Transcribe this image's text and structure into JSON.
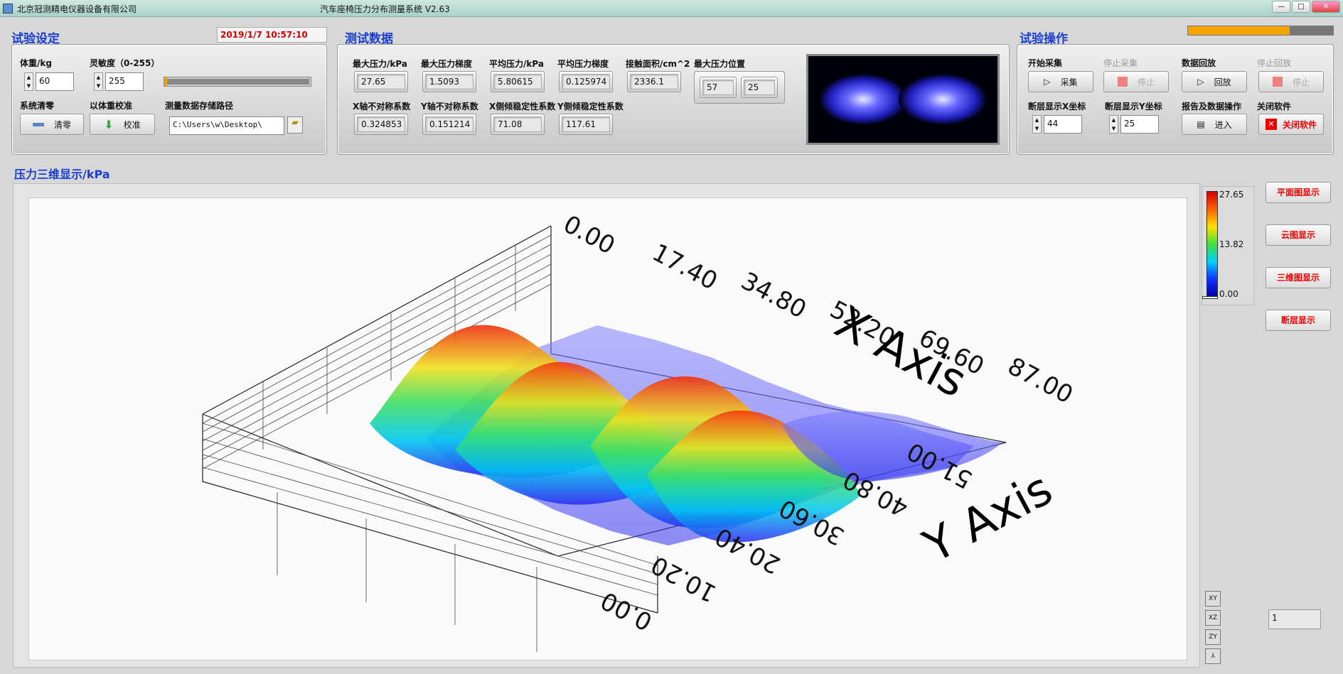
{
  "window": {
    "company": "北京冠测精电仪器设备有限公司",
    "title": "汽车座椅压力分布测量系统 V2.63",
    "buttons": [
      "—",
      "□",
      "✕"
    ]
  },
  "setup": {
    "title": "试验设定",
    "datetime": "2019/1/7   10:57:10",
    "weight_label": "体重/kg",
    "weight_value": "60",
    "sensitivity_label": "灵敏度（0-255）",
    "sensitivity_value": "255",
    "zero_label": "系统清零",
    "zero_button": "清零",
    "calib_label": "以体重校准",
    "calib_button": "校准",
    "path_label": "测量数据存储路径",
    "path_value": "C:\\Users\\w\\Desktop\\"
  },
  "test_data": {
    "title": "测试数据",
    "row1": [
      {
        "label": "最大压力/kPa",
        "value": "27.65"
      },
      {
        "label": "最大压力梯度",
        "value": "1.5093"
      },
      {
        "label": "平均压力/kPa",
        "value": "5.80615"
      },
      {
        "label": "平均压力梯度",
        "value": "0.125974"
      },
      {
        "label": "接触面积/cm^2",
        "value": "2336.1"
      }
    ],
    "max_pos_label": "最大压力位置",
    "max_pos_x": "57",
    "max_pos_y": "25",
    "row2": [
      {
        "label": "X轴不对称系数",
        "value": "0.324853"
      },
      {
        "label": "Y轴不对称系数",
        "value": "0.151214"
      },
      {
        "label": "X侧倾稳定性系数",
        "value": "71.08"
      },
      {
        "label": "Y侧倾稳定性系数",
        "value": "117.61"
      }
    ]
  },
  "operation": {
    "title": "试验操作",
    "progress": 0.7,
    "start_label": "开始采集",
    "start_button": "采集",
    "stop_label": "停止采集",
    "stop_button": "停止",
    "replay_label": "数据回放",
    "replay_button": "回放",
    "stop_replay_label": "停止回放",
    "stop_replay_button": "停止",
    "x_label": "断层显示X坐标",
    "x_value": "44",
    "y_label": "断层显示Y坐标",
    "y_value": "25",
    "report_label": "报告及数据操作",
    "report_button": "进入",
    "close_label": "关闭软件",
    "close_button": "关闭软件"
  },
  "plot": {
    "title": "压力三维显示/kPa",
    "x_axis_title": "X Axis",
    "y_axis_title": "Y Axis",
    "x_ticks": [
      "0.00",
      "17.40",
      "34.80",
      "52.20",
      "69.60",
      "87.00"
    ],
    "y_ticks": [
      "0.00",
      "10.20",
      "20.40",
      "30.60",
      "40.80",
      "51.00"
    ],
    "colorbar": {
      "max": "27.65",
      "mid": "13.82",
      "min": "0.00"
    }
  },
  "side_buttons": [
    "平面图显示",
    "云图显示",
    "三维图显示",
    "断层显示"
  ],
  "counter": "1",
  "colors": {
    "accent": "#1a3fd0",
    "danger": "#e00000",
    "progress": "#f5a300"
  }
}
